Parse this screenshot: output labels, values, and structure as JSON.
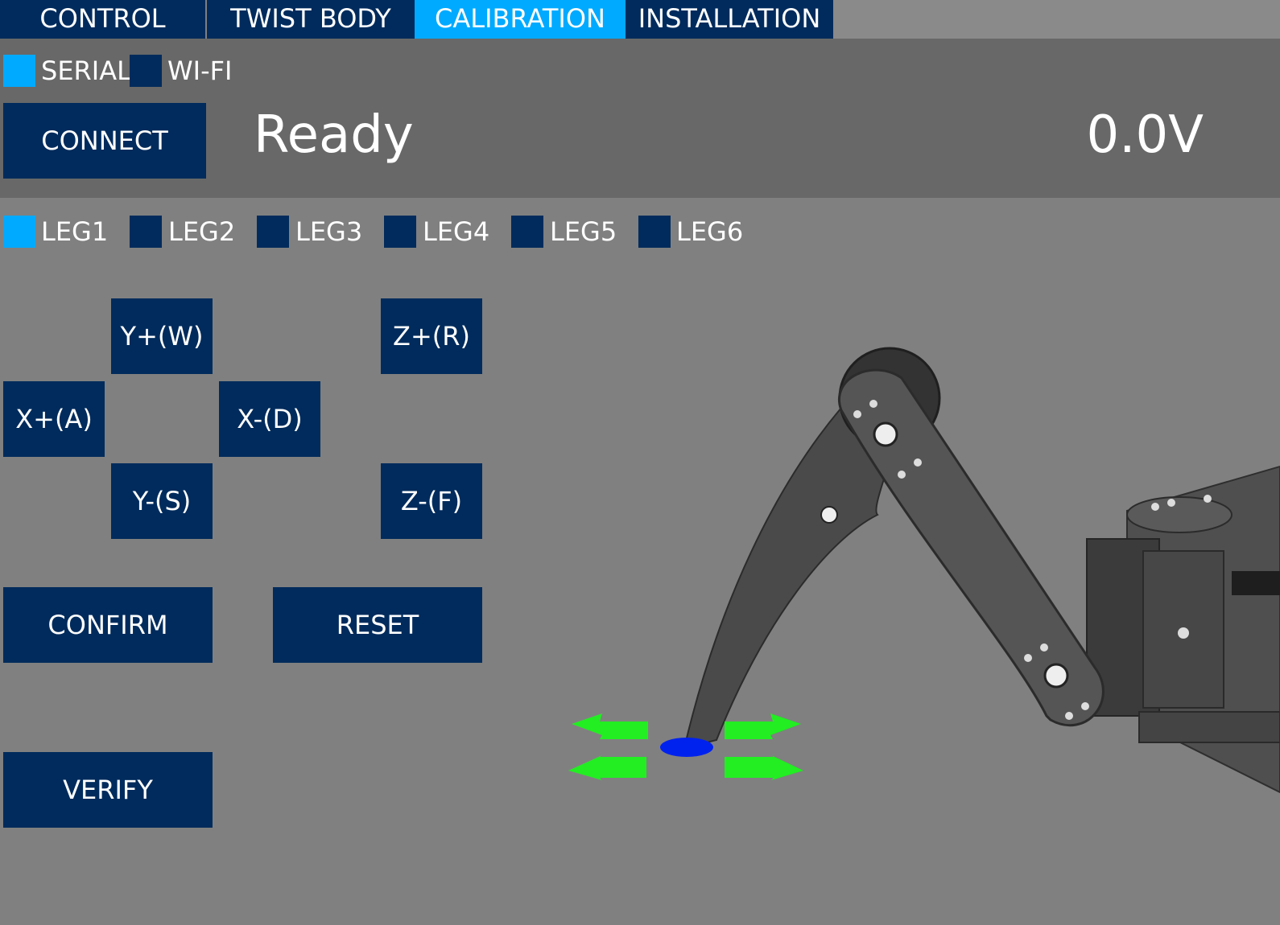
{
  "tabs": [
    {
      "label": "CONTROL",
      "active": false
    },
    {
      "label": "TWIST BODY",
      "active": false
    },
    {
      "label": "CALIBRATION",
      "active": true
    },
    {
      "label": "INSTALLATION",
      "active": false
    }
  ],
  "connection": {
    "serial_label": "SERIAL",
    "serial_selected": true,
    "wifi_label": "WI-FI",
    "wifi_selected": false,
    "connect_label": "CONNECT"
  },
  "status": {
    "message": "Ready",
    "voltage": "0.0V"
  },
  "legs": {
    "selected": "LEG1",
    "items": [
      "LEG1",
      "LEG2",
      "LEG3",
      "LEG4",
      "LEG5",
      "LEG6"
    ]
  },
  "jog": {
    "y_plus": "Y+(W)",
    "x_plus": "X+(A)",
    "x_minus": "X-(D)",
    "y_minus": "Y-(S)",
    "z_plus": "Z+(R)",
    "z_minus": "Z-(F)"
  },
  "actions": {
    "confirm": "CONFIRM",
    "reset": "RESET",
    "verify": "VERIFY"
  },
  "colors": {
    "selected": "#00aaff",
    "unselected": "#002b5c",
    "background": "#808080",
    "status_panel": "#686868",
    "target_marker": "#0022ee",
    "guide_arrows": "#22ee22"
  }
}
